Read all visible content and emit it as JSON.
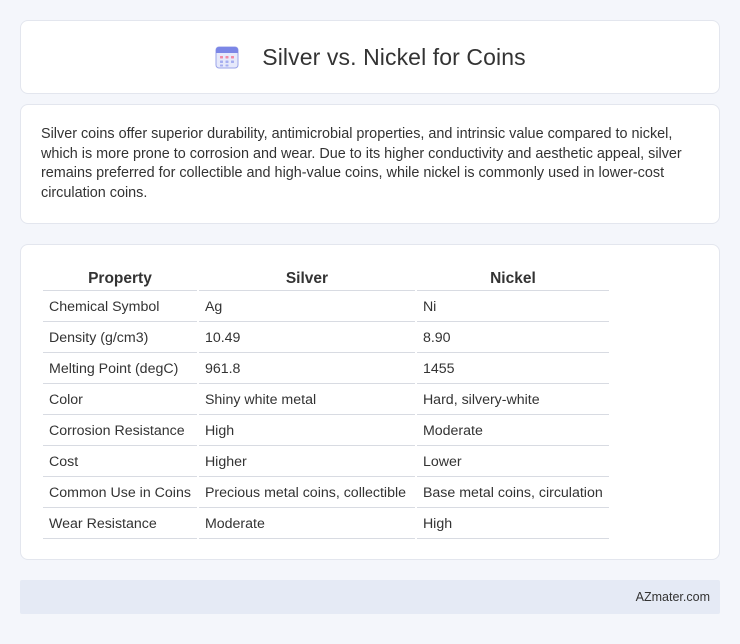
{
  "header": {
    "title": "Silver vs. Nickel for Coins",
    "icon": "calendar-icon"
  },
  "summary": {
    "text": "Silver coins offer superior durability, antimicrobial properties, and intrinsic value compared to nickel, which is more prone to corrosion and wear. Due to its higher conductivity and aesthetic appeal, silver remains preferred for collectible and high-value coins, while nickel is commonly used in lower-cost circulation coins."
  },
  "table": {
    "headers": [
      "Property",
      "Silver",
      "Nickel"
    ],
    "rows": [
      [
        "Chemical Symbol",
        "Ag",
        "Ni"
      ],
      [
        "Density (g/cm3)",
        "10.49",
        "8.90"
      ],
      [
        "Melting Point (degC)",
        "961.8",
        "1455"
      ],
      [
        "Color",
        "Shiny white metal",
        "Hard, silvery-white"
      ],
      [
        "Corrosion Resistance",
        "High",
        "Moderate"
      ],
      [
        "Cost",
        "Higher",
        "Lower"
      ],
      [
        "Common Use in Coins",
        "Precious metal coins, collectible",
        "Base metal coins, circulation"
      ],
      [
        "Wear Resistance",
        "Moderate",
        "High"
      ]
    ]
  },
  "footer": {
    "brand": "AZmater.com"
  }
}
